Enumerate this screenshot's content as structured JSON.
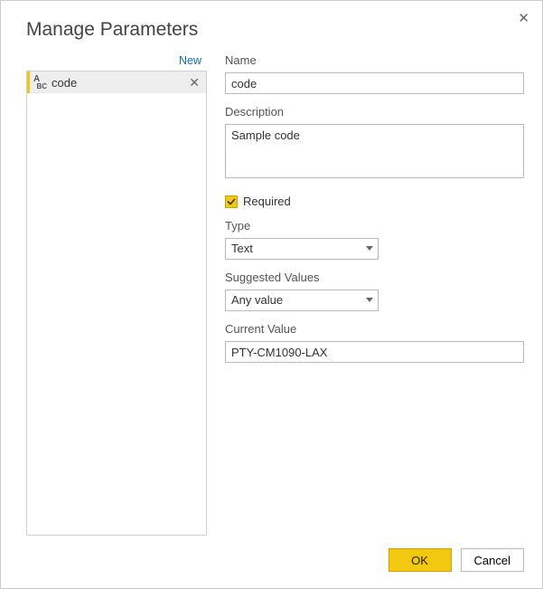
{
  "dialog": {
    "title": "Manage Parameters",
    "new_label": "New"
  },
  "params": {
    "items": [
      {
        "name": "code"
      }
    ]
  },
  "form": {
    "name_label": "Name",
    "name_value": "code",
    "description_label": "Description",
    "description_value": "Sample code",
    "required_label": "Required",
    "required_checked": true,
    "type_label": "Type",
    "type_value": "Text",
    "suggested_label": "Suggested Values",
    "suggested_value": "Any value",
    "current_label": "Current Value",
    "current_value": "PTY-CM1090-LAX"
  },
  "footer": {
    "ok": "OK",
    "cancel": "Cancel"
  }
}
